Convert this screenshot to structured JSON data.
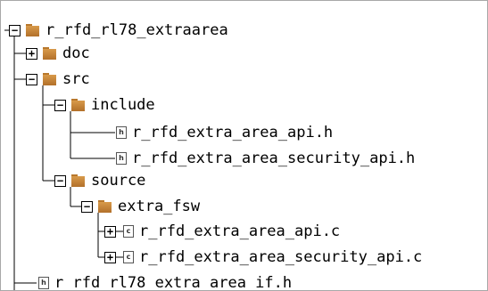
{
  "tree": {
    "root": {
      "label": "r_rfd_rl78_extraarea",
      "toggle": "−",
      "icon": "folder-icon"
    },
    "doc": {
      "label": "doc",
      "toggle": "+",
      "icon": "folder-icon"
    },
    "src": {
      "label": "src",
      "toggle": "−",
      "icon": "folder-icon"
    },
    "include": {
      "label": "include",
      "toggle": "−",
      "icon": "folder-icon"
    },
    "include_api_h": {
      "label": "r_rfd_extra_area_api.h",
      "icon": "header-file-icon",
      "glyph": "h"
    },
    "include_security_api_h": {
      "label": "r_rfd_extra_area_security_api.h",
      "icon": "header-file-icon",
      "glyph": "h"
    },
    "source": {
      "label": "source",
      "toggle": "−",
      "icon": "folder-icon"
    },
    "extra_fsw": {
      "label": "extra_fsw",
      "toggle": "−",
      "icon": "folder-icon"
    },
    "api_c": {
      "label": "r_rfd_extra_area_api.c",
      "toggle": "+",
      "icon": "c-file-icon",
      "glyph": "c"
    },
    "security_api_c": {
      "label": "r_rfd_extra_area_security_api.c",
      "toggle": "+",
      "icon": "c-file-icon",
      "glyph": "c"
    },
    "if_h": {
      "label": "r_rfd_rl78_extra_area_if.h",
      "icon": "header-file-icon",
      "glyph": "h"
    }
  }
}
